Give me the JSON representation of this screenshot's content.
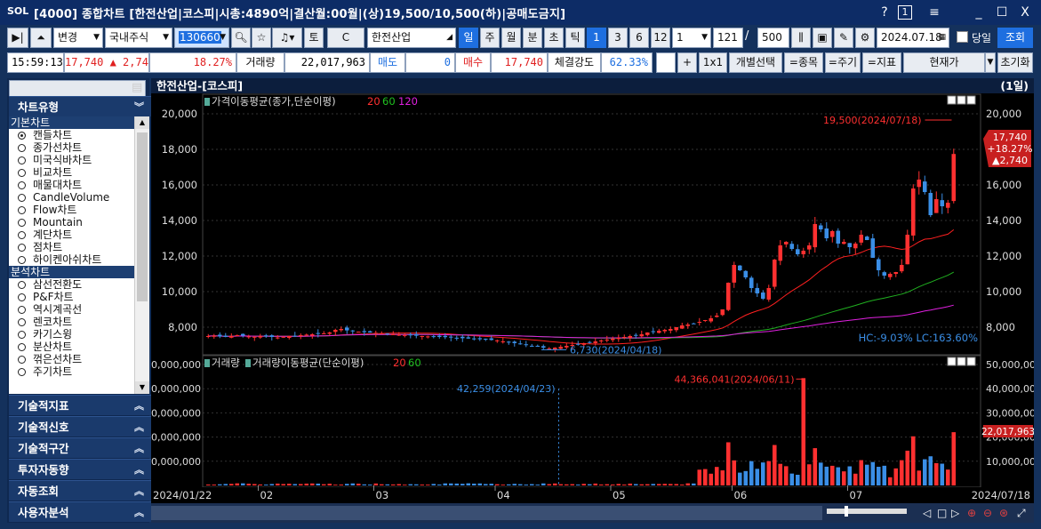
{
  "titlebar": {
    "logo": "SOL",
    "title": "[4000] 종합차트 [한전산업|코스피|시총:4890억|결산월:00월|(상)19,500/10,500(하)|공매도금지]",
    "help": "?",
    "b1": "1",
    "menu": "≡",
    "min": "_",
    "max": "☐",
    "close": "X"
  },
  "toolbar1": {
    "change_label": "변경",
    "market": "국내주식",
    "code": "130660",
    "name": "한전산업",
    "to": "토",
    "c": "C",
    "periods": [
      "일",
      "주",
      "월",
      "분",
      "초",
      "틱"
    ],
    "nums": [
      "1",
      "3",
      "6",
      "12"
    ],
    "num_sel": "1",
    "count": "121",
    "slash": "/",
    "total": "500",
    "date": "2024.07.18",
    "today_label": "당일",
    "query_label": "조회"
  },
  "toolbar2": {
    "time": "15:59:13",
    "price": "17,740",
    "change": "▲ 2,740",
    "rate": "18.27%",
    "vol_label": "거래량",
    "volume": "22,017,963",
    "sell_label": "매도",
    "sell_val": "0",
    "buy_label": "매수",
    "buy_val": "17,740",
    "strength_label": "체결강도",
    "strength": "62.33%",
    "plus": "+",
    "onex": "1x1",
    "indiv": "개별선택",
    "eq_stock": "=종목",
    "eq_period": "=주기",
    "eq_ind": "=지표",
    "curprice": "현재가",
    "reset": "초기화"
  },
  "sidebar": {
    "header": "차트유형",
    "groups": [
      {
        "name": "기본차트",
        "items": [
          "캔들차트",
          "종가선차트",
          "미국식바차트",
          "비교차트",
          "매물대차트",
          "CandleVolume",
          "Flow차트",
          "Mountain",
          "계단차트",
          "점차트",
          "하이켄아쉬차트"
        ]
      },
      {
        "name": "분석차트",
        "items": [
          "삼선전환도",
          "P&F차트",
          "역시계곡선",
          "렌코차트",
          "카기스윙",
          "분산차트",
          "꺾은선차트",
          "주기차트"
        ]
      }
    ],
    "sections": [
      "기술적지표",
      "기술적신호",
      "기술적구간",
      "투자자동향",
      "자동조회",
      "사용자분석"
    ]
  },
  "chart": {
    "header_title": "한전산업-[코스피]",
    "period": "(1일)",
    "price_legend": "가격이동평균(종가,단순이평)",
    "price_ma": [
      "20",
      "60",
      "120"
    ],
    "volume_legend1": "거래량",
    "volume_legend2": "거래량이동평균(단순이평)",
    "volume_ma": [
      "20",
      "60"
    ],
    "high_annot": "19,500(2024/07/18)",
    "low_annot": "6,730(2024/04/18)",
    "hc_lc": "HC:-9.03%  LC:163.60%",
    "vol_high_annot": "44,366,041(2024/06/11)",
    "vol_low_annot": "42,259(2024/04/23)",
    "cur_price_box": [
      "17,740",
      "+18.27%",
      "▲2,740"
    ],
    "cur_vol_box": "22,017,963",
    "x_start": "2024/01/22",
    "x_end": "2024/07/18",
    "months": [
      "02",
      "03",
      "04",
      "05",
      "06",
      "07"
    ],
    "price_ticks": [
      "20,000",
      "18,000",
      "16,000",
      "14,000",
      "12,000",
      "10,000",
      "8,000"
    ],
    "vol_ticks": [
      "50,000,000",
      "40,000,000",
      "30,000,000",
      "20,000,000",
      "10,000,000"
    ],
    "up_color": "#ff3030",
    "down_color": "#3a8ee6",
    "ma20_color": "#ff2020",
    "ma60_color": "#20b020",
    "ma120_color": "#e020e0"
  },
  "chart_data": {
    "type": "candlestick",
    "xlabel": "",
    "ylabel": "",
    "ylim": [
      7000,
      20500
    ],
    "closes": [
      7500,
      7520,
      7480,
      7450,
      7500,
      7550,
      7520,
      7480,
      7460,
      7500,
      7480,
      7450,
      7420,
      7460,
      7500,
      7520,
      7550,
      7580,
      7600,
      7620,
      7650,
      7700,
      7850,
      7900,
      7820,
      7780,
      7750,
      7720,
      7700,
      7680,
      7650,
      7620,
      7600,
      7580,
      7560,
      7540,
      7520,
      7500,
      7480,
      7460,
      7450,
      7440,
      7420,
      7400,
      7380,
      7360,
      7340,
      7320,
      7300,
      7280,
      7260,
      7200,
      7150,
      7100,
      7050,
      7000,
      6950,
      6900,
      6850,
      6800,
      6850,
      6900,
      6950,
      7000,
      7050,
      7100,
      7150,
      7200,
      7250,
      7300,
      7350,
      7400,
      7450,
      7500,
      7550,
      7600,
      7700,
      7750,
      7800,
      7850,
      7900,
      8000,
      8100,
      8150,
      8200,
      8300,
      8400,
      8500,
      8650,
      9000,
      10500,
      11500,
      11200,
      10800,
      10200,
      9900,
      9600,
      10200,
      11800,
      12600,
      12800,
      12400,
      12100,
      12300,
      12600,
      13800,
      13500,
      13000,
      13400,
      12700,
      12800,
      12500,
      12700,
      13200,
      12900,
      11900,
      11200,
      10900,
      11000,
      11100,
      11500,
      13200,
      15800,
      16300,
      15600,
      14300,
      15200,
      14800,
      15000,
      17740
    ],
    "ma20_last": 13300,
    "ma60_last": 10800,
    "ma120_last": 9100,
    "volume_peak": 44366041,
    "volume_last": 22017963,
    "high": {
      "value": 19500,
      "date": "2024/07/18"
    },
    "low": {
      "value": 6730,
      "date": "2024/04/18"
    }
  }
}
